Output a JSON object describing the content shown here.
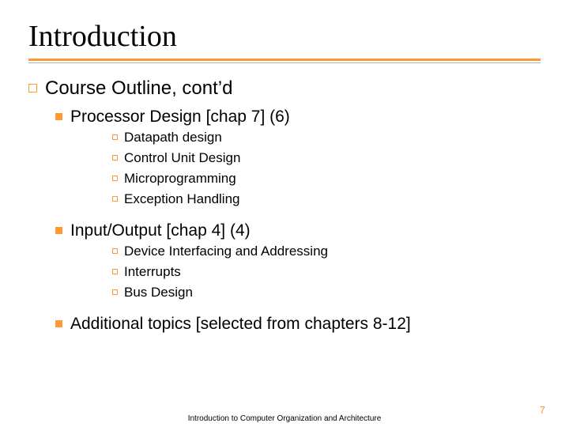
{
  "title": "Introduction",
  "lvl1": {
    "label": "Course Outline, cont’d"
  },
  "sections": [
    {
      "heading": "Processor Design [chap 7] (6)",
      "items": [
        "Datapath design",
        "Control Unit Design",
        "Microprogramming",
        "Exception Handling"
      ]
    },
    {
      "heading": "Input/Output [chap 4] (4)",
      "items": [
        "Device Interfacing and Addressing",
        "Interrupts",
        "Bus Design"
      ]
    },
    {
      "heading": "Additional topics [selected from chapters 8-12]",
      "items": []
    }
  ],
  "footer": {
    "center": "Introduction to Computer Organization and Architecture",
    "page": "7"
  }
}
